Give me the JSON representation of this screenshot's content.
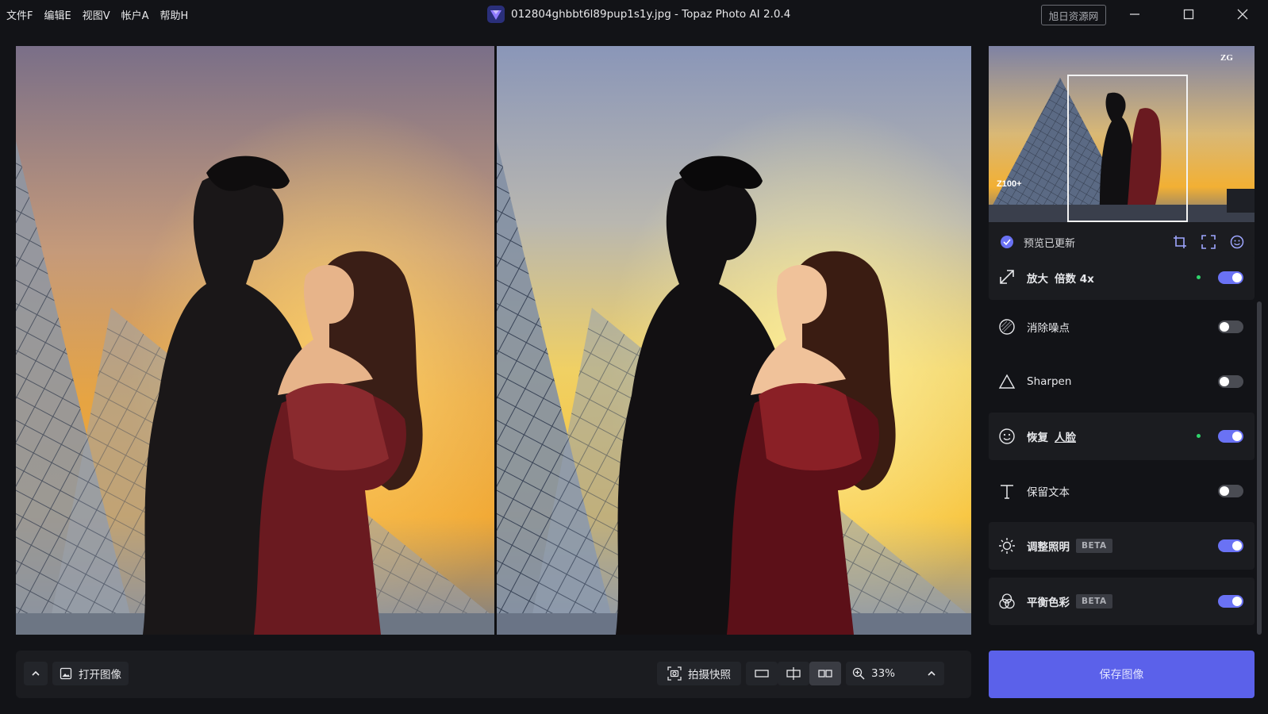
{
  "menu": [
    "文件F",
    "编辑E",
    "视图V",
    "帐户A",
    "帮助H"
  ],
  "window": {
    "title": "012804ghbbt6l89pup1s1y.jpg - Topaz Photo AI 2.0.4",
    "resource_button": "旭日资源网"
  },
  "preview": {
    "status": "预览已更新"
  },
  "panels": [
    {
      "label": "放大",
      "extra": "倍数 4x",
      "enabled": true,
      "modified": true
    },
    {
      "label": "消除噪点",
      "enabled": false
    },
    {
      "label": "Sharpen",
      "enabled": false
    },
    {
      "label": "恢复",
      "extra": "人脸",
      "enabled": true,
      "modified": true
    },
    {
      "label": "保留文本",
      "enabled": false
    },
    {
      "label": "调整照明",
      "badge": "BETA",
      "enabled": true
    },
    {
      "label": "平衡色彩",
      "badge": "BETA",
      "enabled": true
    }
  ],
  "bottombar": {
    "open_image": "打开图像",
    "snapshot": "拍摄快照",
    "zoom": "33%"
  },
  "save_button": "保存图像",
  "colors": {
    "accent": "#6a72f4",
    "save": "#5b61ea",
    "modified_dot": "#2fd46b",
    "background": "#121317",
    "panel": "#1b1c20"
  }
}
